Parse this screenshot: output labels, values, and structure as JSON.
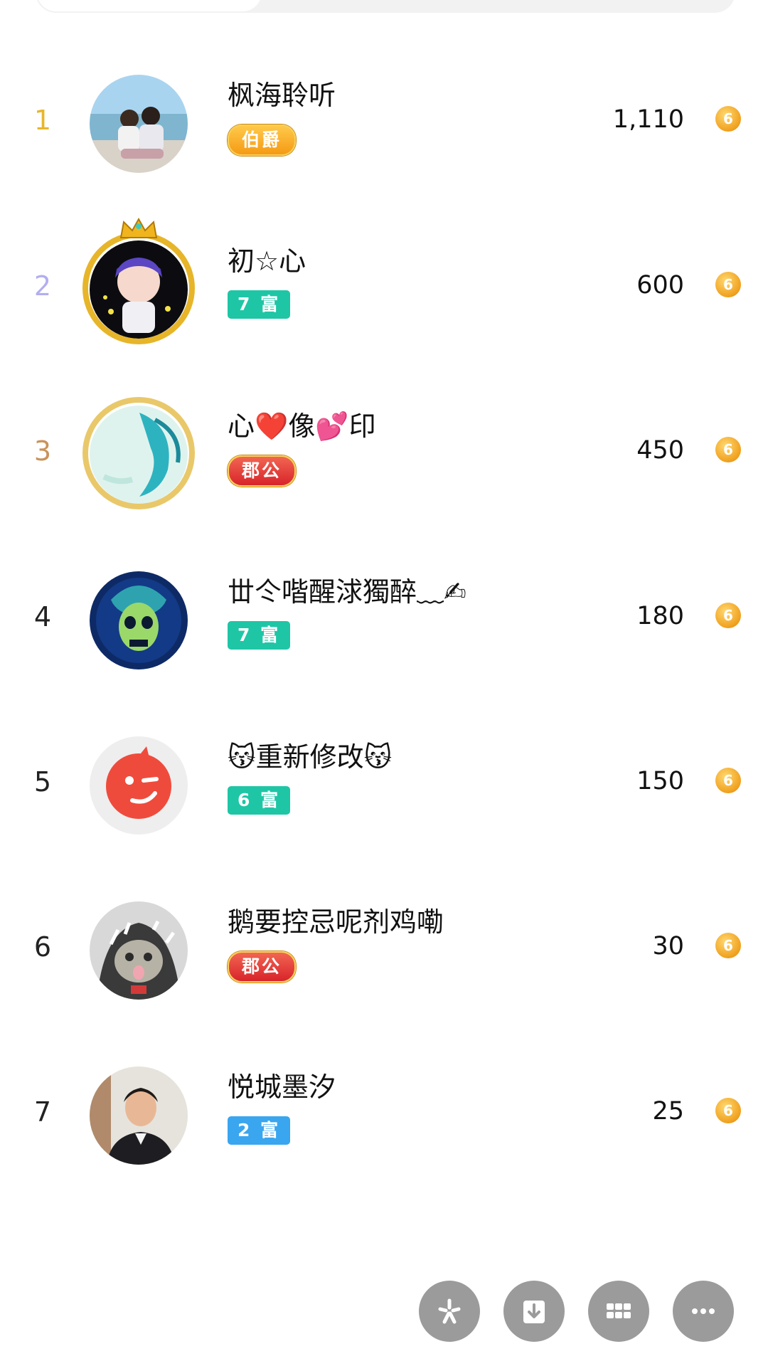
{
  "ranking": [
    {
      "rank": "1",
      "name": "枫海聆听",
      "badge": "伯爵",
      "badge_type": "noble-gold",
      "score": "1,110",
      "rank_color": "#e8b62c"
    },
    {
      "rank": "2",
      "name": "初☆心",
      "badge": "7 富",
      "badge_type": "wealth",
      "score": "600",
      "rank_color": "#b3aef0"
    },
    {
      "rank": "3",
      "name": "心❤️像💕印",
      "badge": "郡公",
      "badge_type": "noble-red",
      "score": "450",
      "rank_color": "#c9935a"
    },
    {
      "rank": "4",
      "name": "丗仒喈醒浗獨醉﹏✍",
      "badge": "7 富",
      "badge_type": "wealth",
      "score": "180",
      "rank_color": "#222222"
    },
    {
      "rank": "5",
      "name": "😽重新修改😽",
      "badge": "6 富",
      "badge_type": "wealth",
      "score": "150",
      "rank_color": "#222222"
    },
    {
      "rank": "6",
      "name": "鹅要控忌呢剂鸡嘞",
      "badge": "郡公",
      "badge_type": "noble-red",
      "score": "30",
      "rank_color": "#222222"
    },
    {
      "rank": "7",
      "name": "悦城墨汐",
      "badge": "2 富",
      "badge_type": "wealth-low",
      "score": "25",
      "rank_color": "#222222"
    }
  ],
  "coin_symbol": "6",
  "fab_icons": [
    "spark-icon",
    "download-icon",
    "grid-icon",
    "more-icon"
  ]
}
